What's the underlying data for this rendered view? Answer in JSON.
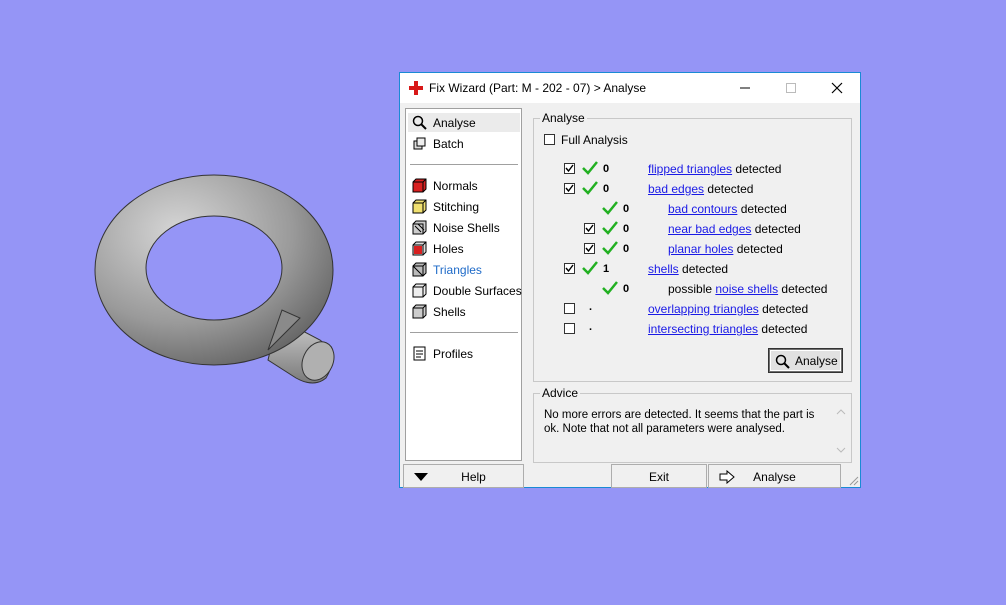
{
  "window": {
    "title": "Fix Wizard (Part: M - 202 - 07) > Analyse"
  },
  "colors": {
    "background": "#9595f6",
    "link": "#1a1ae6",
    "check": "#22b022",
    "nav_active": "#1e6ac8"
  },
  "nav": {
    "top": [
      {
        "label": "Analyse",
        "icon": "magnifier-icon"
      },
      {
        "label": "Batch",
        "icon": "batch-icon"
      }
    ],
    "middle": [
      {
        "label": "Normals",
        "icon": "normals-cube-icon"
      },
      {
        "label": "Stitching",
        "icon": "stitching-cube-icon"
      },
      {
        "label": "Noise Shells",
        "icon": "noise-shells-icon"
      },
      {
        "label": "Holes",
        "icon": "holes-cube-icon"
      },
      {
        "label": "Triangles",
        "icon": "triangles-cube-icon"
      },
      {
        "label": "Double Surfaces",
        "icon": "double-surfaces-icon"
      },
      {
        "label": "Shells",
        "icon": "shells-icon"
      }
    ],
    "bottom": [
      {
        "label": "Profiles",
        "icon": "profiles-icon"
      }
    ]
  },
  "analyse": {
    "group_label": "Analyse",
    "full_analysis_label": "Full Analysis",
    "full_analysis_checked": false,
    "rows": [
      {
        "count": "0",
        "link": "flipped triangles",
        "suffix": "detected"
      },
      {
        "count": "0",
        "link": "bad edges",
        "suffix": "detected"
      },
      {
        "count": "0",
        "link": "bad contours",
        "suffix": "detected"
      },
      {
        "count": "0",
        "link": "near bad edges",
        "suffix": "detected"
      },
      {
        "count": "0",
        "link": "planar holes",
        "suffix": "detected"
      },
      {
        "count": "1",
        "link": "shells",
        "suffix": "detected"
      },
      {
        "count": "0",
        "prefix": "possible",
        "link": "noise shells",
        "suffix": "detected"
      },
      {
        "count": ".",
        "link": "overlapping triangles",
        "suffix": "detected"
      },
      {
        "count": ".",
        "link": "intersecting triangles",
        "suffix": "detected"
      }
    ],
    "button_label": "Analyse"
  },
  "advice": {
    "group_label": "Advice",
    "text": "No more errors are detected. It seems that the part is ok. Note that not all parameters were analysed."
  },
  "bottom": {
    "help_label": "Help",
    "exit_label": "Exit",
    "analyse_label": "Analyse"
  }
}
